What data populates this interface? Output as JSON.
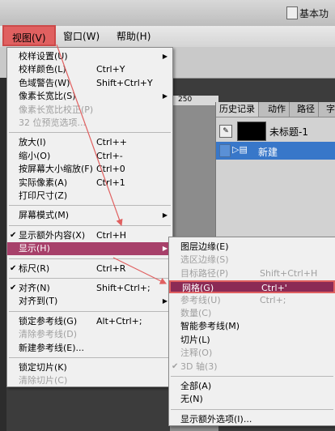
{
  "workspace_label": "基本功",
  "menubar": {
    "view": "视图(V)",
    "window": "窗口(W)",
    "help": "帮助(H)"
  },
  "ruler": "250",
  "history_panel": {
    "tabs": [
      "历史记录",
      "动作",
      "路径",
      "字"
    ],
    "snapshot_label": "未标题-1",
    "row_label": "新建"
  },
  "view_menu": {
    "items": [
      {
        "label": "校样设置(U)",
        "shortcut": "",
        "arrow": true,
        "disabled": false
      },
      {
        "label": "校样颜色(L)",
        "shortcut": "Ctrl+Y",
        "disabled": false
      },
      {
        "label": "色域警告(W)",
        "shortcut": "Shift+Ctrl+Y",
        "disabled": false
      },
      {
        "label": "像素长宽比(S)",
        "shortcut": "",
        "arrow": true,
        "disabled": false
      },
      {
        "label": "像素长宽比校正(P)",
        "shortcut": "",
        "disabled": true
      },
      {
        "label": "32 位预览选项...",
        "shortcut": "",
        "disabled": true
      },
      {
        "label": "放大(I)",
        "shortcut": "Ctrl++",
        "disabled": false
      },
      {
        "label": "缩小(O)",
        "shortcut": "Ctrl+-",
        "disabled": false
      },
      {
        "label": "按屏幕大小缩放(F)",
        "shortcut": "Ctrl+0",
        "disabled": false
      },
      {
        "label": "实际像素(A)",
        "shortcut": "Ctrl+1",
        "disabled": false
      },
      {
        "label": "打印尺寸(Z)",
        "shortcut": "",
        "disabled": false
      },
      {
        "label": "屏幕模式(M)",
        "shortcut": "",
        "arrow": true,
        "disabled": false
      },
      {
        "label": "显示额外内容(X)",
        "shortcut": "Ctrl+H",
        "checked": true,
        "disabled": false
      },
      {
        "label": "显示(H)",
        "shortcut": "",
        "arrow": true,
        "highlighted": true,
        "disabled": false
      },
      {
        "label": "标尺(R)",
        "shortcut": "Ctrl+R",
        "checked": true,
        "disabled": false
      },
      {
        "label": "对齐(N)",
        "shortcut": "Shift+Ctrl+;",
        "checked": true,
        "disabled": false
      },
      {
        "label": "对齐到(T)",
        "shortcut": "",
        "arrow": true,
        "disabled": false
      },
      {
        "label": "锁定参考线(G)",
        "shortcut": "Alt+Ctrl+;",
        "disabled": false
      },
      {
        "label": "清除参考线(D)",
        "shortcut": "",
        "disabled": true
      },
      {
        "label": "新建参考线(E)...",
        "shortcut": "",
        "disabled": false
      },
      {
        "label": "锁定切片(K)",
        "shortcut": "",
        "disabled": false
      },
      {
        "label": "清除切片(C)",
        "shortcut": "",
        "disabled": true
      }
    ]
  },
  "show_submenu": {
    "items": [
      {
        "label": "图层边缘(E)",
        "shortcut": "",
        "disabled": false
      },
      {
        "label": "选区边缘(S)",
        "shortcut": "",
        "disabled": true
      },
      {
        "label": "目标路径(P)",
        "shortcut": "Shift+Ctrl+H",
        "disabled": true
      },
      {
        "label": "网格(G)",
        "shortcut": "Ctrl+'",
        "highlighted": true,
        "disabled": false
      },
      {
        "label": "参考线(U)",
        "shortcut": "Ctrl+;",
        "disabled": true
      },
      {
        "label": "数量(C)",
        "shortcut": "",
        "disabled": true
      },
      {
        "label": "智能参考线(M)",
        "shortcut": "",
        "disabled": false
      },
      {
        "label": "切片(L)",
        "shortcut": "",
        "disabled": false
      },
      {
        "label": "注释(O)",
        "shortcut": "",
        "disabled": true
      },
      {
        "label": "3D 轴(3)",
        "shortcut": "",
        "checked": true,
        "disabled": true
      },
      {
        "label": "全部(A)",
        "shortcut": "",
        "disabled": false
      },
      {
        "label": "无(N)",
        "shortcut": "",
        "disabled": false
      },
      {
        "label": "显示额外选项(I)...",
        "shortcut": "",
        "disabled": false
      }
    ]
  },
  "colors": {
    "highlight": "#a7406a",
    "annotation_red": "#e06060",
    "history_selected": "#3877c9"
  }
}
